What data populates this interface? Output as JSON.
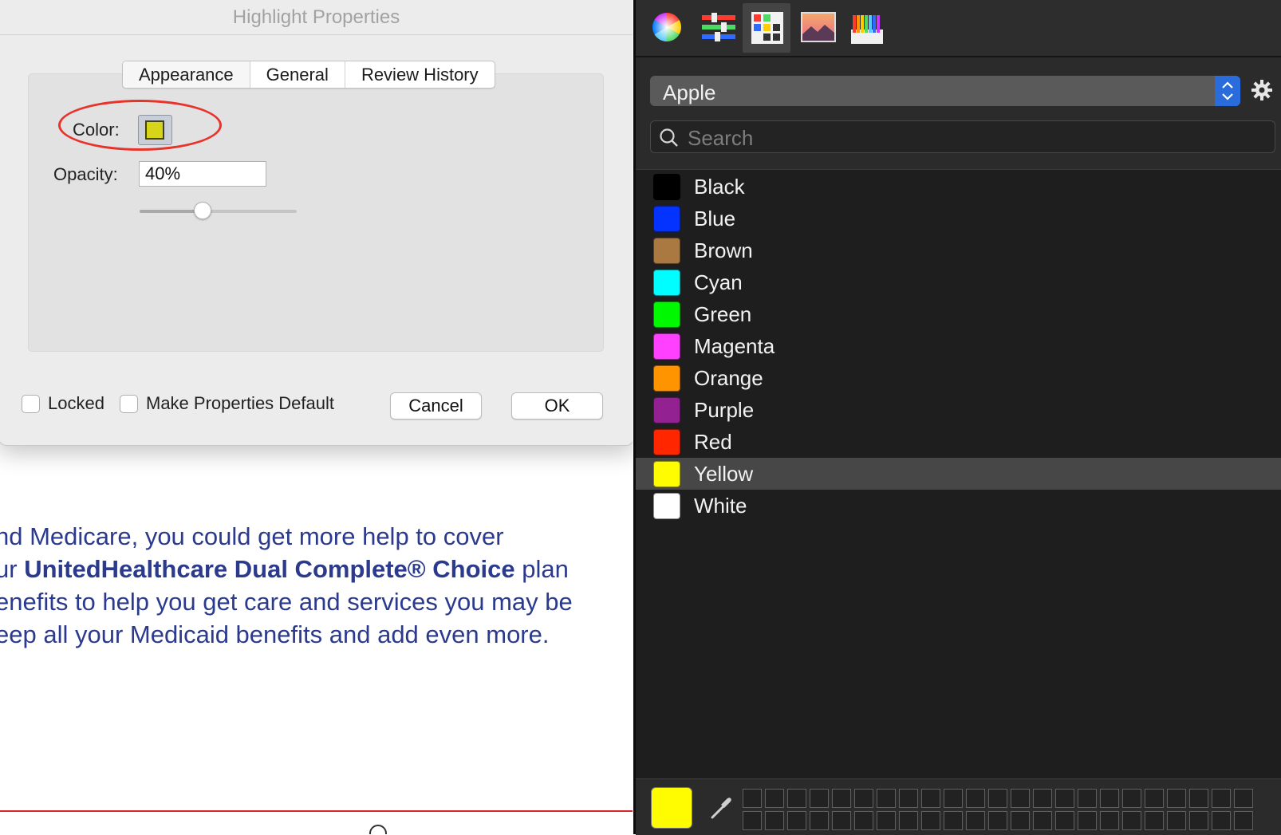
{
  "document": {
    "lines": [
      {
        "pre": "nd Medicare, you could get more help to cover",
        "bold": "",
        "post": ""
      },
      {
        "pre": "ur ",
        "bold": "UnitedHealthcare Dual Complete® Choice",
        "post": " plan"
      },
      {
        "pre": "enefits to help you get care and services you may be",
        "bold": "",
        "post": ""
      },
      {
        "pre": "eep all your Medicaid benefits and add even more.",
        "bold": "",
        "post": ""
      }
    ]
  },
  "dialog": {
    "title": "Highlight Properties",
    "tabs": [
      "Appearance",
      "General",
      "Review History"
    ],
    "color_label": "Color:",
    "color_value": "#d6d51a",
    "opacity_label": "Opacity:",
    "opacity_value": "40%",
    "opacity_fraction": 0.4,
    "locked_label": "Locked",
    "make_default_label": "Make Properties Default",
    "cancel_label": "Cancel",
    "ok_label": "OK",
    "annotation_color": "#e8332a"
  },
  "picker": {
    "toolbar": [
      {
        "name": "color-wheel-icon",
        "active": false
      },
      {
        "name": "color-sliders-icon",
        "active": false
      },
      {
        "name": "color-palettes-icon",
        "active": true
      },
      {
        "name": "image-palettes-icon",
        "active": false
      },
      {
        "name": "pencils-icon",
        "active": false
      }
    ],
    "list_name": "Apple",
    "search_placeholder": "Search",
    "colors": [
      {
        "name": "Black",
        "hex": "#000000"
      },
      {
        "name": "Blue",
        "hex": "#0433ff"
      },
      {
        "name": "Brown",
        "hex": "#aa7942"
      },
      {
        "name": "Cyan",
        "hex": "#00fdff"
      },
      {
        "name": "Green",
        "hex": "#00f900"
      },
      {
        "name": "Magenta",
        "hex": "#ff40ff"
      },
      {
        "name": "Orange",
        "hex": "#ff9300"
      },
      {
        "name": "Purple",
        "hex": "#942192"
      },
      {
        "name": "Red",
        "hex": "#ff2600"
      },
      {
        "name": "Yellow",
        "hex": "#fffb00"
      },
      {
        "name": "White",
        "hex": "#ffffff"
      }
    ],
    "selected_color": "Yellow",
    "current_color": "#fffb00",
    "accent": "#2a6cdb"
  }
}
